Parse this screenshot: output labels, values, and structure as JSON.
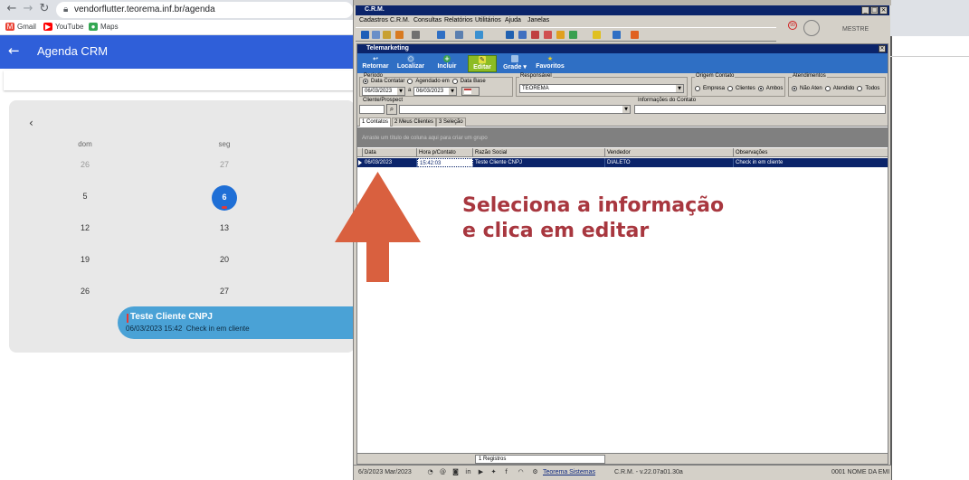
{
  "browser": {
    "url": "vendorflutter.teorema.inf.br/agenda",
    "bookmarks": [
      {
        "label": "Gmail",
        "icon": "gmail-icon",
        "color": "#ea4335"
      },
      {
        "label": "YouTube",
        "icon": "youtube-icon",
        "color": "#ff0000"
      },
      {
        "label": "Maps",
        "icon": "maps-icon",
        "color": "#34a853"
      }
    ]
  },
  "flutter_app": {
    "title": "Agenda CRM",
    "accent_color": "#2f5fd9",
    "weekdays": [
      "dom",
      "seg"
    ],
    "weeks": [
      [
        "26",
        "27"
      ],
      [
        "5",
        "6"
      ],
      [
        "12",
        "13"
      ],
      [
        "19",
        "20"
      ],
      [
        "26",
        "27"
      ]
    ],
    "selected_day": "6",
    "event": {
      "title": "Teste Cliente CNPJ",
      "date": "06/03/2023",
      "time": "15:42",
      "note": "Check in em cliente"
    }
  },
  "crm": {
    "window_title": "C.R.M.",
    "menu": [
      "Cadastros",
      "C.R.M.",
      "Consultas",
      "Relatórios",
      "Utilitários",
      "Ajuda",
      "Janelas"
    ],
    "user_name": "MESTRE",
    "telemarketing": {
      "title": "Telemarketing",
      "toolbar": {
        "retornar": "Retornar",
        "localizar": "Localizar",
        "incluir": "Incluir",
        "editar": "Editar",
        "grade": "Grade",
        "favoritos": "Favoritos"
      },
      "periodo": {
        "label": "Período",
        "options": [
          "Data Contatar",
          "Agendado em",
          "Data Base"
        ],
        "date_from": "06/03/2023",
        "sep": "a",
        "date_to": "06/03/2023"
      },
      "responsavel": {
        "label": "Responsável",
        "value": "TEOREMA"
      },
      "origem": {
        "label": "Origem Contato",
        "options": [
          "Empresa",
          "Clientes",
          "Ambos"
        ]
      },
      "atendimentos": {
        "label": "Atendimentos",
        "options": [
          "Não Aten",
          "Atendido",
          "Todos"
        ]
      },
      "cliente_label": "Cliente/Prospect",
      "info_label": "Informações do Contato",
      "tabs": [
        "1 Contatos",
        "2 Meus Clientes",
        "3 Seleção"
      ],
      "group_hint": "Arraste um título de coluna aqui para criar um grupo",
      "columns": [
        "Data",
        "Hora p/Contato",
        "Razão Social",
        "Vendedor",
        "Observações"
      ],
      "rows": [
        {
          "data": "06/03/2023",
          "hora": "15:42:03",
          "razao": "Teste Cliente CNPJ",
          "vendedor": "DIALETO",
          "obs": "Check in em cliente"
        }
      ],
      "record_count": "1 Registros"
    },
    "status": {
      "date": "6/3/2023 Mar/2023",
      "brand": "Teorema Sistemas",
      "version": "C.R.M. - v.22.07a01.30a",
      "company": "0001 NOME DA EMI"
    }
  },
  "annotation": {
    "text": "Seleciona a informação\ne clica em editar",
    "color": "#a8373f",
    "arrow_color": "#d9603f"
  }
}
